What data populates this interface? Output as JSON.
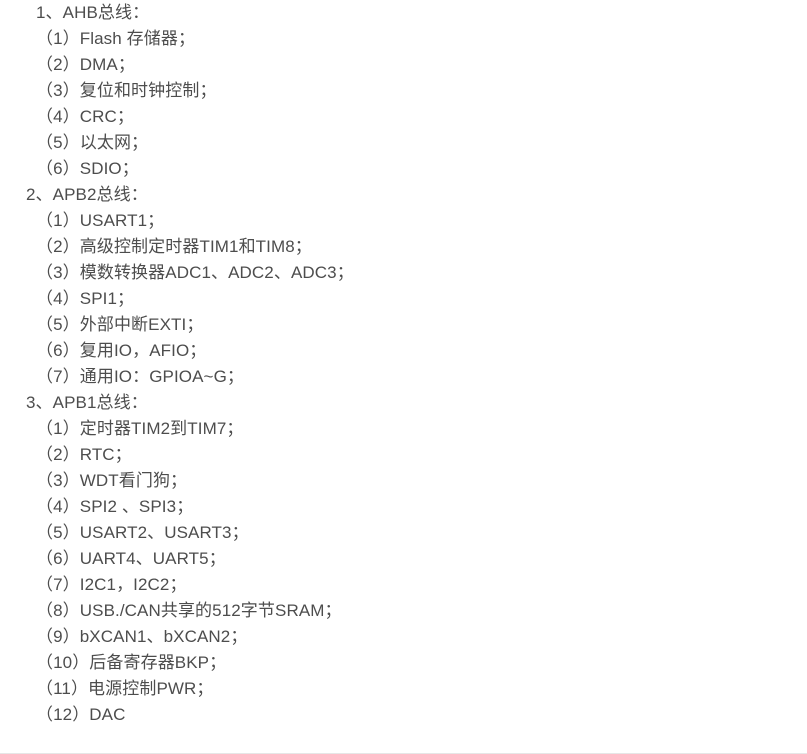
{
  "document": {
    "lines": [
      " 1、AHB总线：",
      "（1）Flash 存储器；",
      "（2）DMA；",
      "（3）复位和时钟控制；",
      "（4）CRC；",
      "（5）以太网；",
      "（6）SDIO；",
      "2、APB2总线：",
      "（1）USART1；",
      "（2）高级控制定时器TIM1和TIM8；",
      "（3）模数转换器ADC1、ADC2、ADC3；",
      "（4）SPI1；",
      "（5）外部中断EXTI；",
      "（6）复用IO，AFIO；",
      "（7）通用IO：GPIOA~G；",
      "3、APB1总线：",
      "（1）定时器TIM2到TIM7；",
      "（2）RTC；",
      "（3）WDT看门狗；",
      "（4）SPI2 、SPI3；",
      "（5）USART2、USART3；",
      "（6）UART4、UART5；",
      "（7）I2C1，I2C2；",
      "（8）USB./CAN共享的512字节SRAM；",
      "（9）bXCAN1、bXCAN2；",
      "（10）后备寄存器BKP；",
      "（11）电源控制PWR；",
      "（12）DAC"
    ]
  }
}
